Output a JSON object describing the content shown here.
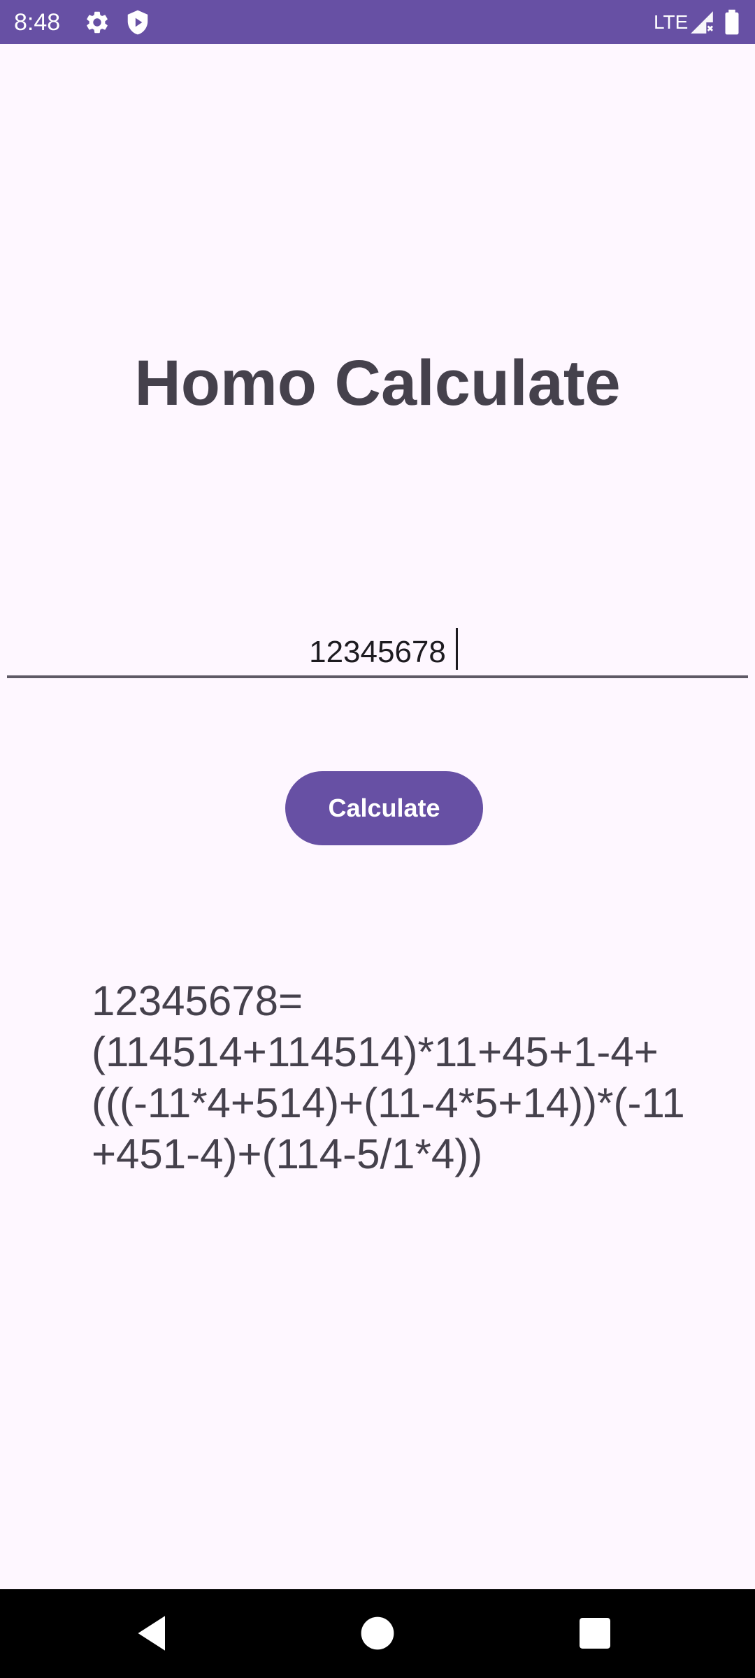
{
  "status_bar": {
    "time": "8:48",
    "network": "LTE",
    "icons": [
      "settings-icon",
      "shield-play-icon",
      "signal-icon",
      "battery-icon"
    ],
    "background": "#6750a4"
  },
  "app": {
    "title": "Homo Calculate",
    "input_value": "12345678",
    "button_label": "Calculate",
    "result": "12345678=\n(114514+114514)*11+45+1-4+\n(((-11*4+514)+(11-4*5+14))*(-11\n+451-4)+(114-5/1*4))",
    "accent_color": "#6750a4",
    "background_color": "#fef7ff"
  },
  "nav_bar": {
    "icons": [
      "back-icon",
      "home-icon",
      "recents-icon"
    ]
  }
}
